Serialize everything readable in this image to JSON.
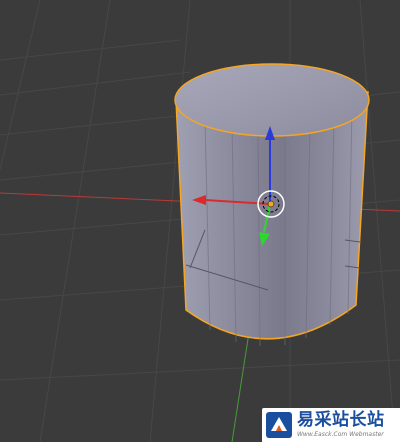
{
  "viewport": {
    "object": "Cylinder",
    "colors": {
      "background": "#3b3b3b",
      "grid": "#4a4a4a",
      "x_axis": "#b83a3a",
      "y_axis": "#4a9a3a",
      "selection_outline": "#f5a623",
      "cylinder_body": "#8a8a9a",
      "cylinder_top": "#9a9aac"
    },
    "manipulator": {
      "x_arrow_color": "#d92b2b",
      "y_arrow_color": "#2bd92b",
      "z_arrow_color": "#2b3bd9"
    }
  },
  "watermark": {
    "title": "易采站长站",
    "url": "Www.Easck.Com Webmaster"
  }
}
